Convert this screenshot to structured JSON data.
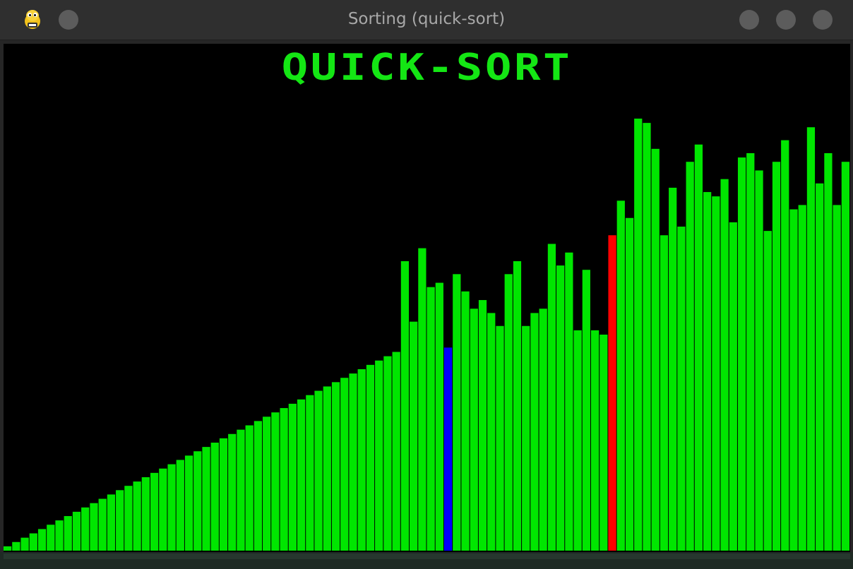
{
  "window": {
    "title": "Sorting (quick-sort)",
    "app_icon": "python-snake-icon"
  },
  "heading": "QUICK-SORT",
  "colors": {
    "bar": "#00e600",
    "pivot": "#0000ff",
    "compare": "#ff0000",
    "background": "#000000",
    "heading": "#14e614"
  },
  "chart_data": {
    "type": "bar",
    "title": "QUICK-SORT",
    "xlabel": "",
    "ylabel": "",
    "ylim": [
      0,
      100
    ],
    "grid": false,
    "legend": "none",
    "highlight": {
      "blue_index": 51,
      "red_index": 70
    },
    "values": [
      1,
      2,
      3,
      4,
      5,
      6,
      7,
      8,
      9,
      10,
      11,
      12,
      13,
      14,
      15,
      16,
      17,
      18,
      19,
      20,
      21,
      22,
      23,
      24,
      25,
      26,
      27,
      28,
      29,
      30,
      31,
      32,
      33,
      34,
      35,
      36,
      37,
      38,
      39,
      40,
      41,
      42,
      43,
      44,
      45,
      46,
      67,
      53,
      70,
      61,
      62,
      47,
      64,
      60,
      56,
      58,
      55,
      52,
      64,
      67,
      52,
      55,
      56,
      71,
      66,
      69,
      51,
      65,
      51,
      50,
      73,
      81,
      77,
      100,
      99,
      93,
      73,
      84,
      75,
      90,
      94,
      83,
      82,
      86,
      76,
      91,
      92,
      88,
      74,
      90,
      95,
      79,
      80,
      98,
      85,
      92,
      80,
      90
    ]
  }
}
